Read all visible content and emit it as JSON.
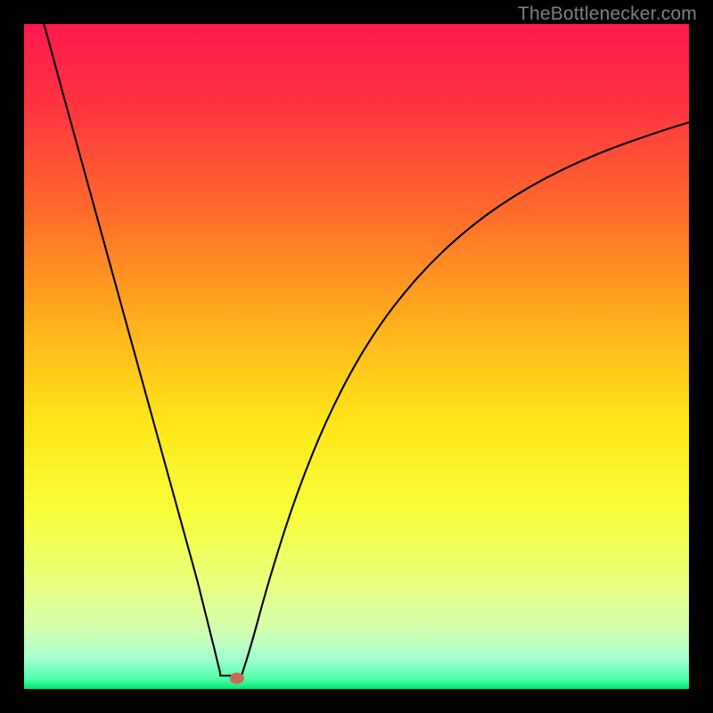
{
  "watermark": "TheBottlenecker.com",
  "chart_data": {
    "type": "line",
    "title": "",
    "xlabel": "",
    "ylabel": "",
    "xlim": [
      0,
      100
    ],
    "ylim": [
      0,
      100
    ],
    "gradient_stops": [
      {
        "offset": 0.0,
        "color": "#ff1a4d"
      },
      {
        "offset": 0.12,
        "color": "#ff3340"
      },
      {
        "offset": 0.28,
        "color": "#ff6a2b"
      },
      {
        "offset": 0.45,
        "color": "#ffb01c"
      },
      {
        "offset": 0.6,
        "color": "#ffe619"
      },
      {
        "offset": 0.74,
        "color": "#f7ff3d"
      },
      {
        "offset": 0.84,
        "color": "#eaff7d"
      },
      {
        "offset": 0.91,
        "color": "#d4ffb0"
      },
      {
        "offset": 0.955,
        "color": "#a4ffce"
      },
      {
        "offset": 0.985,
        "color": "#4dffad"
      },
      {
        "offset": 1.0,
        "color": "#00e86b"
      }
    ],
    "curve": {
      "min_x": 30.5,
      "left": [
        {
          "x": 3.0,
          "y": 100.0
        },
        {
          "x": 6.0,
          "y": 89.0
        },
        {
          "x": 10.0,
          "y": 74.5
        },
        {
          "x": 14.0,
          "y": 60.0
        },
        {
          "x": 18.0,
          "y": 45.5
        },
        {
          "x": 22.0,
          "y": 31.0
        },
        {
          "x": 26.0,
          "y": 16.5
        },
        {
          "x": 28.5,
          "y": 6.5
        },
        {
          "x": 29.5,
          "y": 2.4
        }
      ],
      "flat": [
        {
          "x": 29.5,
          "y": 2.0
        },
        {
          "x": 32.7,
          "y": 2.0
        }
      ],
      "right": [
        {
          "x": 32.7,
          "y": 2.0
        },
        {
          "x": 34.0,
          "y": 6.0
        },
        {
          "x": 37.0,
          "y": 17.0
        },
        {
          "x": 41.0,
          "y": 29.5
        },
        {
          "x": 46.0,
          "y": 41.8
        },
        {
          "x": 52.0,
          "y": 52.8
        },
        {
          "x": 59.0,
          "y": 62.0
        },
        {
          "x": 67.0,
          "y": 69.6
        },
        {
          "x": 76.0,
          "y": 75.7
        },
        {
          "x": 86.0,
          "y": 80.5
        },
        {
          "x": 96.0,
          "y": 84.0
        },
        {
          "x": 100.0,
          "y": 85.2
        }
      ]
    },
    "marker": {
      "x": 32.0,
      "y": 1.6,
      "rx": 1.1,
      "ry": 0.85,
      "color": "#c96a55"
    }
  }
}
